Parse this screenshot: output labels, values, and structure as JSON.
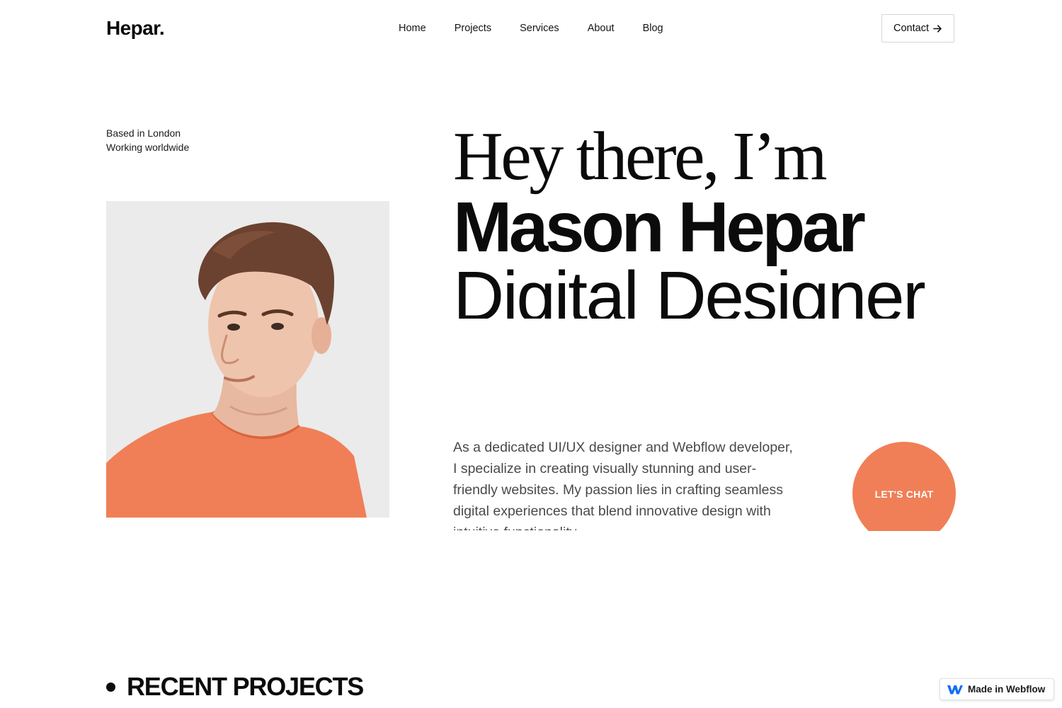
{
  "brand": {
    "logo": "Hepar."
  },
  "nav": {
    "items": [
      "Home",
      "Projects",
      "Services",
      "About",
      "Blog"
    ],
    "contact_label": "Contact",
    "contact_icon": "arrow-right-icon"
  },
  "location": {
    "line1": "Based in London",
    "line2": "Working worldwide"
  },
  "hero": {
    "greeting": "Hey there, I’m",
    "name": "Mason Hepar",
    "role": "Digital Designer",
    "portrait": "portrait-photo"
  },
  "bio": {
    "text": "As a dedicated UI/UX designer and Webflow developer, I specialize in creating visually stunning and user-friendly websites. My passion lies in crafting seamless digital experiences that blend innovative design with intuitive functionality."
  },
  "cta": {
    "chat_label": "LET'S CHAT"
  },
  "sections": {
    "recent_projects": "RECENT PROJECTS"
  },
  "badge": {
    "label": "Made in Webflow",
    "icon": "webflow-logo-icon"
  },
  "colors": {
    "accent": "#f07f57",
    "text": "#0b0b0b",
    "body_text": "#4a4a4a",
    "background": "#ffffff"
  }
}
